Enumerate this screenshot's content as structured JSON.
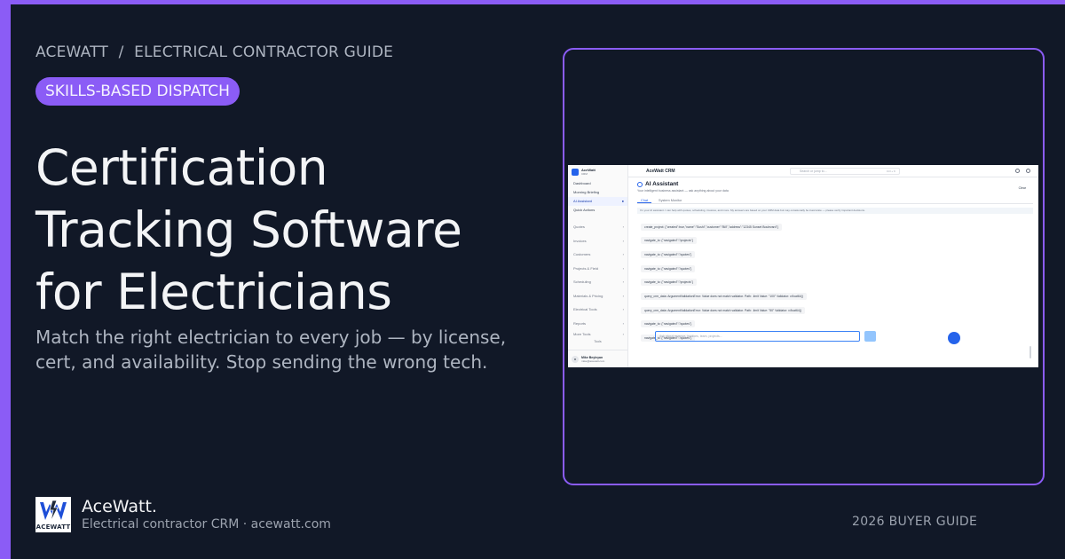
{
  "colors": {
    "background": "#111827",
    "accent": "#8b5cf6"
  },
  "breadcrumb": {
    "brand": "ACEWATT",
    "separator": "/",
    "section": "ELECTRICAL CONTRACTOR GUIDE"
  },
  "pill": {
    "label": "SKILLS-BASED DISPATCH"
  },
  "headline": {
    "lines": [
      "Certification",
      "Tracking Software",
      "for Electricians"
    ]
  },
  "subtext": "Match the right electrician to every job — by license, cert, and availability. Stop sending the wrong tech.",
  "brand": {
    "logo_word": "ACEWATT",
    "name": "AceWatt.",
    "tagline": "Electrical contractor CRM · acewatt.com"
  },
  "guide_label": "2026 BUYER GUIDE",
  "screenshot": {
    "app_brand_title": "AceWatt",
    "app_brand_sub": "CRM",
    "top_title": "AceWatt CRM",
    "search_placeholder": "Search or jump to...",
    "search_shortcut": "Ctrl + K",
    "sidebar_items": [
      {
        "label": "Dashboard"
      },
      {
        "label": "Morning Briefing"
      },
      {
        "label": "AI Assistant",
        "active": true
      },
      {
        "label": "Quick Actions"
      }
    ],
    "sidebar_sections": [
      "Quotes",
      "Invoices",
      "Customers",
      "Projects & Field",
      "Scheduling",
      "Materials & Pricing",
      "Electrical Tools",
      "Reports",
      "More Tools"
    ],
    "tools_label": "Tools",
    "user": {
      "initials": "M",
      "name": "Mike Beyleyan",
      "email": "mike@acewatt.com"
    },
    "page_title": "AI Assistant",
    "page_subtitle": "Your intelligent business assistant — ask anything about your data",
    "clear_label": "Clear",
    "tabs": [
      "Chat",
      "System Monitor"
    ],
    "notice": "I'm your AI assistant. I can help with quotes, scheduling, invoices, and more. My answers are based on your CRM data but may occasionally be inaccurate — please verify important decisions.",
    "messages": [
      "create_project: {\"created\":true,\"name\":\"Sushi\",\"customer\":\"Bill\",\"address\":\"12345 Sunset Boulevard\"}",
      "navigate_to: {\"navigated\":\"/projects\"}",
      "navigate_to: {\"navigated\":\"/quotes\"}",
      "navigate_to: {\"navigated\":\"/quotes\"}",
      "navigate_to: {\"navigated\":\"/projects\"}",
      "query_crm_data: ArgumentValidationError: Value does not match validator. Path: .limit Value: \"100\" Validator: v.float64()",
      "query_crm_data: ArgumentValidationError: Value does not match validator. Path: .limit Value: \"50\" Validator: v.float64()",
      "navigate_to: {\"navigated\":\"/quotes\"}",
      "navigate_to: {\"navigated\":\"/quotes\"}"
    ],
    "input_placeholder": "Ask about revenue, invoices, team, projects..."
  }
}
